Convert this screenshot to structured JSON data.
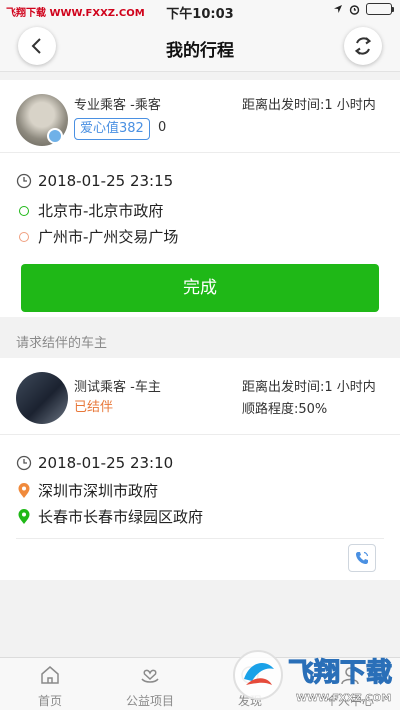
{
  "status_bar": {
    "site": "飞翔下载 WWW.FXXZ.COM",
    "time": "下午10:03"
  },
  "nav": {
    "title": "我的行程"
  },
  "trip": {
    "passenger": {
      "name": "专业乘客 -乘客",
      "love_label": "爱心值382",
      "love_count": "0",
      "depart": "距离出发时间:1 小时内"
    },
    "datetime": "2018-01-25 23:15",
    "from": "北京市-北京市政府",
    "to": "广州市-广州交易广场",
    "complete_button": "完成"
  },
  "section_title": "请求结伴的车主",
  "driver": {
    "name": "测试乘客 -车主",
    "status": "已结伴",
    "depart": "距离出发时间:1 小时内",
    "match": "顺路程度:50%",
    "datetime": "2018-01-25 23:10",
    "from": "深圳市深圳市政府",
    "to": "长春市长春市绿园区政府"
  },
  "tabs": [
    {
      "label": "首页",
      "icon": "home-icon"
    },
    {
      "label": "公益项目",
      "icon": "charity-icon"
    },
    {
      "label": "发现",
      "icon": "discover-icon"
    },
    {
      "label": "个人中心",
      "icon": "profile-icon"
    }
  ],
  "watermark": {
    "text": "飞翔下载",
    "url": "WWW.FXXZ.COM"
  },
  "colors": {
    "green": "#1fb817",
    "blue": "#4a90e2",
    "orange": "#e8783a",
    "pin_orange": "#f08a3c",
    "pin_green": "#1fb817"
  }
}
